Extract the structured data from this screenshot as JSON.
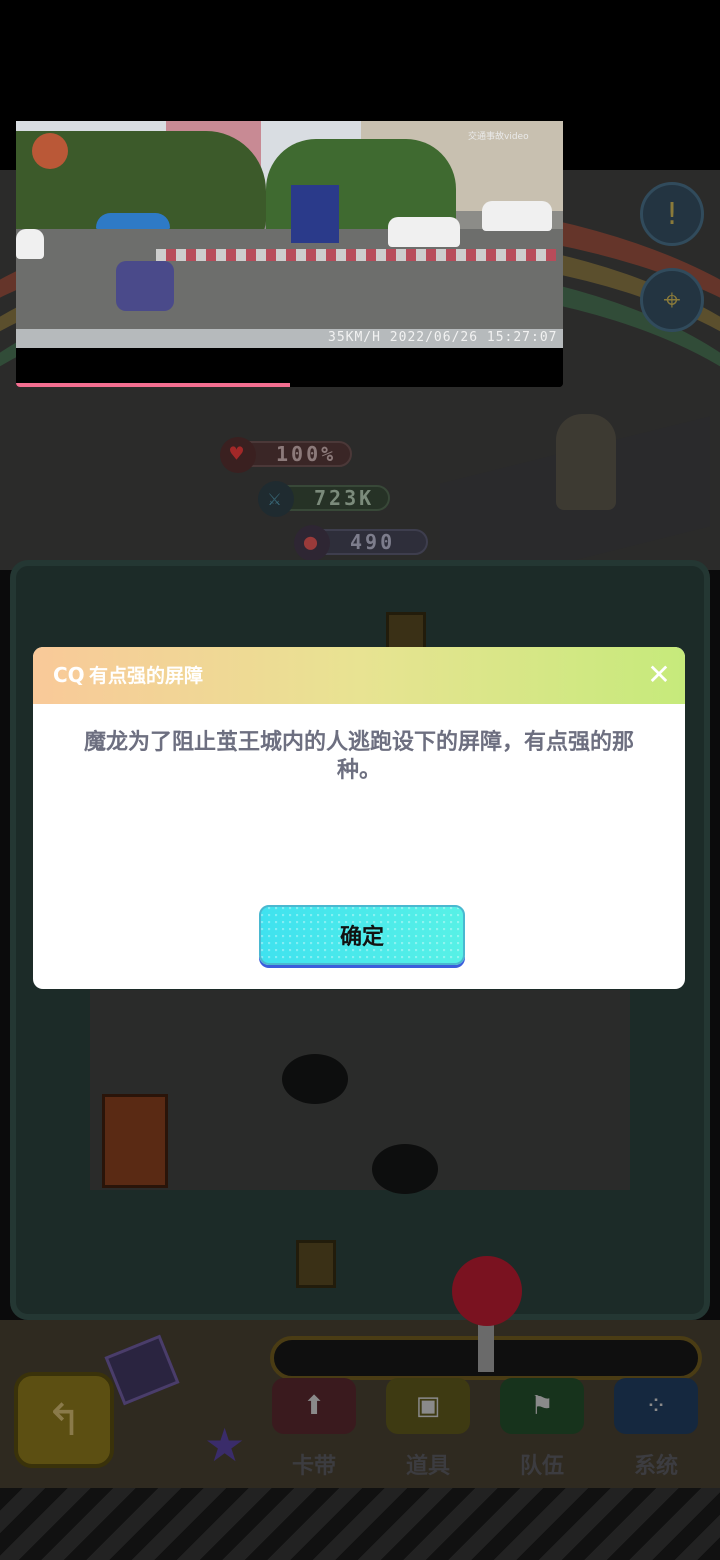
{
  "game": {
    "stats": {
      "hp": "100%",
      "attack": "723K",
      "coins": "490"
    },
    "menu": [
      {
        "label": "卡带",
        "color": "#3a1a1e"
      },
      {
        "label": "道具",
        "color": "#3e3a12"
      },
      {
        "label": "队伍",
        "color": "#17331c"
      },
      {
        "label": "系统",
        "color": "#15283f"
      }
    ]
  },
  "video": {
    "watermark": "交通事故video",
    "timestamp": "35KM/H 2022/06/26 15:27:07",
    "progress": 0.5
  },
  "dialog": {
    "title": "有点强的屏障",
    "message": "魔龙为了阻止茧王城内的人逃跑设下的屏障，有点强的那种。",
    "confirm_label": "确定",
    "close_glyph": "✕"
  }
}
